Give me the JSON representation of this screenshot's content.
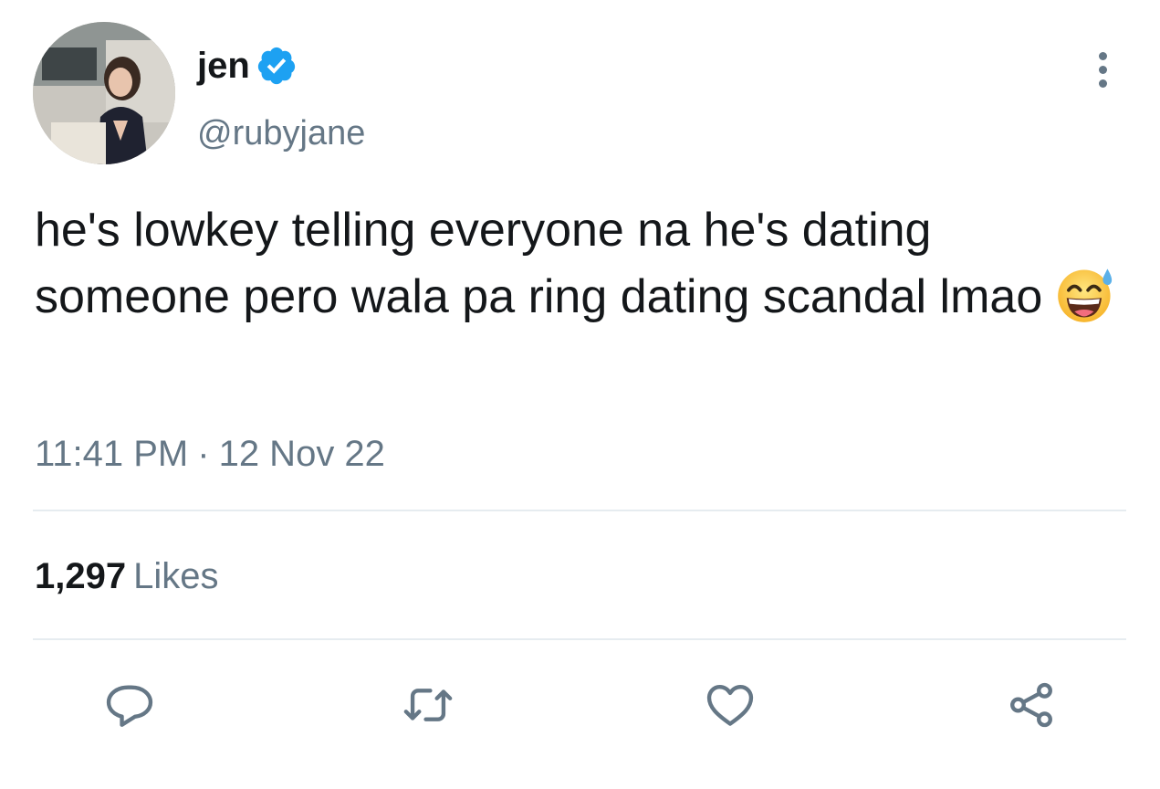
{
  "author": {
    "display_name": "jen",
    "handle": "@rubyjane",
    "verified": true,
    "verified_icon": "verified-badge-icon",
    "avatar": "profile-photo"
  },
  "tweet": {
    "text": "he's lowkey telling everyone na he's dating someone pero wala pa ring dating scandal lmao",
    "emoji": "😅",
    "time": "11:41 PM",
    "separator": "·",
    "date": "12 Nov 22"
  },
  "stats": {
    "likes_count": "1,297",
    "likes_label": "Likes"
  },
  "actions": [
    {
      "name": "reply",
      "icon": "reply-icon"
    },
    {
      "name": "retweet",
      "icon": "retweet-icon"
    },
    {
      "name": "like",
      "icon": "heart-icon"
    },
    {
      "name": "share",
      "icon": "share-icon"
    }
  ],
  "menu": {
    "icon": "more-vertical-icon"
  },
  "colors": {
    "text_primary": "#14171a",
    "text_secondary": "#657786",
    "verified_blue": "#1da1f2",
    "divider": "#e6ecf0",
    "background": "#ffffff"
  }
}
